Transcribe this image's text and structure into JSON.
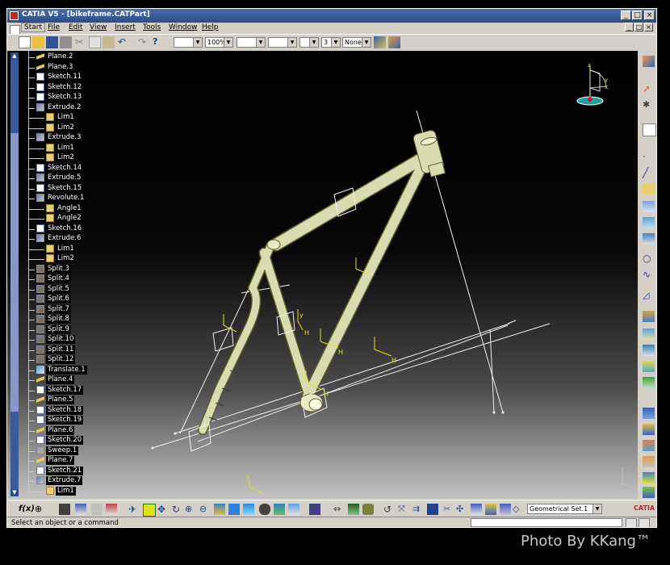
{
  "window": {
    "title": "CATIA V5 - [bikeframe.CATPart]",
    "controls": [
      "_",
      "□",
      "×"
    ]
  },
  "menu": {
    "items": [
      "Start",
      "File",
      "Edit",
      "View",
      "Insert",
      "Tools",
      "Window",
      "Help"
    ],
    "doc_controls": [
      "_",
      "□",
      "×"
    ]
  },
  "toolbar": {
    "zoom_value": "100%",
    "layer_value": "None",
    "weight_value": "3"
  },
  "tree": {
    "items": [
      {
        "label": "Plane.2",
        "icon": "plane-icon"
      },
      {
        "label": "Plane.3",
        "icon": "plane-icon"
      },
      {
        "label": "Sketch.11",
        "icon": "sketch-icon"
      },
      {
        "label": "Sketch.12",
        "icon": "sketch-icon"
      },
      {
        "label": "Sketch.13",
        "icon": "sketch-icon"
      },
      {
        "label": "Extrude.2",
        "icon": "extrude-icon"
      },
      {
        "label": "Lim1",
        "icon": "limit-icon"
      },
      {
        "label": "Lim2",
        "icon": "limit-icon"
      },
      {
        "label": "Extrude.3",
        "icon": "extrude-icon"
      },
      {
        "label": "Lim1",
        "icon": "limit-icon"
      },
      {
        "label": "Lim2",
        "icon": "limit-icon"
      },
      {
        "label": "Sketch.14",
        "icon": "sketch-icon"
      },
      {
        "label": "Extrude.5",
        "icon": "extrude-icon"
      },
      {
        "label": "Sketch.15",
        "icon": "sketch-icon"
      },
      {
        "label": "Revolute.1",
        "icon": "revolute-icon"
      },
      {
        "label": "Angle1",
        "icon": "limit-icon"
      },
      {
        "label": "Angle2",
        "icon": "limit-icon"
      },
      {
        "label": "Sketch.16",
        "icon": "sketch-icon"
      },
      {
        "label": "Extrude.6",
        "icon": "extrude-icon"
      },
      {
        "label": "Lim1",
        "icon": "limit-icon"
      },
      {
        "label": "Lim2",
        "icon": "limit-icon"
      },
      {
        "label": "Split.3",
        "icon": "split-icon"
      },
      {
        "label": "Split.4",
        "icon": "split-icon"
      },
      {
        "label": "Split.5",
        "icon": "split-icon"
      },
      {
        "label": "Split.6",
        "icon": "split-icon"
      },
      {
        "label": "Split.7",
        "icon": "split-icon"
      },
      {
        "label": "Split.8",
        "icon": "split-icon"
      },
      {
        "label": "Split.9",
        "icon": "split-icon"
      },
      {
        "label": "Split.10",
        "icon": "split-icon"
      },
      {
        "label": "Split.11",
        "icon": "split-icon"
      },
      {
        "label": "Split.12",
        "icon": "split-icon"
      },
      {
        "label": "Translate.1",
        "icon": "translate-icon"
      },
      {
        "label": "Plane.4",
        "icon": "plane-icon"
      },
      {
        "label": "Sketch.17",
        "icon": "sketch-icon"
      },
      {
        "label": "Plane.5",
        "icon": "plane-icon"
      },
      {
        "label": "Sketch.18",
        "icon": "sketch-icon"
      },
      {
        "label": "Sketch.19",
        "icon": "sketch-icon"
      },
      {
        "label": "Plane.6",
        "icon": "plane-icon"
      },
      {
        "label": "Sketch.20",
        "icon": "sketch-icon"
      },
      {
        "label": "Sweep.1",
        "icon": "sweep-icon"
      },
      {
        "label": "Plane.7",
        "icon": "plane-icon"
      },
      {
        "label": "Sketch.21",
        "icon": "sketch-icon"
      },
      {
        "label": "Extrude.7",
        "icon": "extrude-icon"
      },
      {
        "label": "Lim1",
        "icon": "limit-icon"
      }
    ]
  },
  "bottom_toolbar": {
    "geometrical_set": "Geometrical Set.1",
    "brand": "CATIA"
  },
  "status": {
    "message": "Select an object or a command"
  },
  "credit": "Photo By KKang™"
}
